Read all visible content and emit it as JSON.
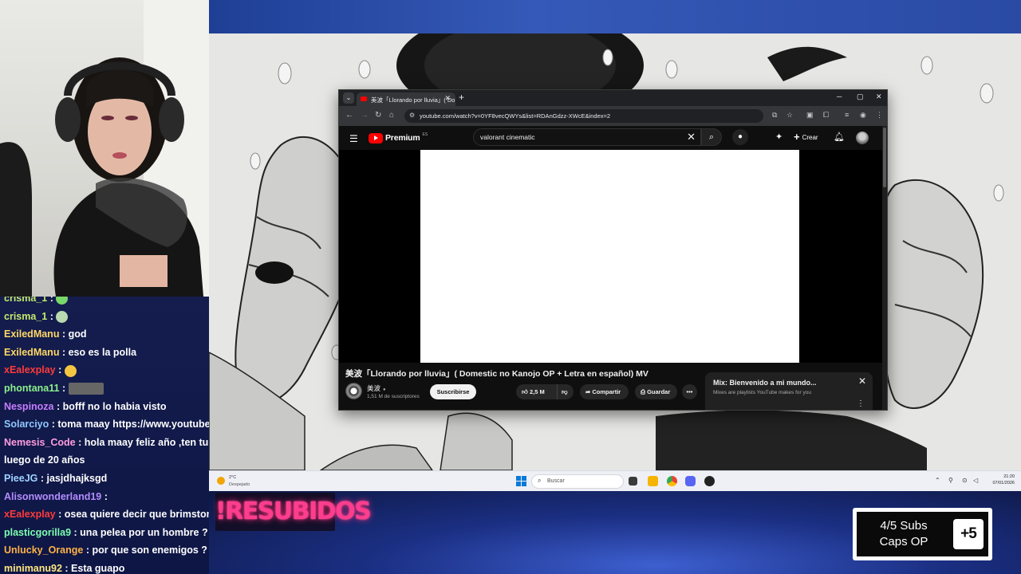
{
  "browser": {
    "tab_title": "美波「Llorando por lluvia」( Dom",
    "url": "youtube.com/watch?v=0YF8vecQWYs&list=RDAnGdzz-XWcE&index=2"
  },
  "youtube": {
    "logo_text": "Premium",
    "logo_region": "ES",
    "search_query": "valorant cinematic",
    "create_label": "Crear",
    "video_title": "美波「Llorando por lluvia」( Domestic no Kanojo OP + Letra en español) MV",
    "channel_name": "美波",
    "channel_subs": "1,51 M de suscriptores",
    "subscribe_label": "Suscribirse",
    "likes": "2,5 M",
    "share_label": "Compartir",
    "save_label": "Guardar",
    "mix_title": "Mix: Bienvenido a mi mundo...",
    "mix_subtitle": "Mixes are playlists YouTube makes for you"
  },
  "taskbar": {
    "temp": "2°C",
    "condition": "Despejado",
    "search_placeholder": "Buscar",
    "time": "21:20",
    "date": "07/01/2026"
  },
  "chat": [
    {
      "user": "crisma_1",
      "color": "#c5e86c",
      "text": "",
      "emote": "#7ad76a"
    },
    {
      "user": "crisma_1",
      "color": "#c5e86c",
      "text": "",
      "emote": "#b9d9b0"
    },
    {
      "user": "ExiledManu",
      "color": "#ffd866",
      "text": "god"
    },
    {
      "user": "ExiledManu",
      "color": "#ffd866",
      "text": "eso es la polla"
    },
    {
      "user": "xEalexplay",
      "color": "#ff3b3b",
      "text": "",
      "emote": "#f5c542"
    },
    {
      "user": "phontana11",
      "color": "#8cf08c",
      "text": "",
      "emote_wide": "#666"
    },
    {
      "user": "Nespinoza",
      "color": "#c77dff",
      "text": "bofff no lo habia visto"
    },
    {
      "user": "Solarciyo",
      "color": "#8fc7ff",
      "text": "toma maay https://www.youtube.c"
    },
    {
      "user": "Nemesis_Code",
      "color": "#ff9ce0",
      "text": "hola maay feliz año ,ten tu p"
    },
    {
      "user": "",
      "color": "#fff",
      "text": "luego de 20 años"
    },
    {
      "user": "PieeJG",
      "color": "#9fd3ff",
      "text": "jasjdhajksgd"
    },
    {
      "user": "Alisonwonderland19",
      "color": "#b48cff",
      "text": ""
    },
    {
      "user": "xEalexplay",
      "color": "#ff3b3b",
      "text": "osea quiere decir que brimstone"
    },
    {
      "user": "plasticgorilla9",
      "color": "#7dffb0",
      "text": "una pelea por un hombre ?"
    },
    {
      "user": "Unlucky_Orange",
      "color": "#ffb347",
      "text": "por que son enemigos ?"
    },
    {
      "user": "minimanu92",
      "color": "#ffe680",
      "text": "Esta guapo"
    }
  ],
  "overlay": {
    "resubidos": "!RESUBIDOS",
    "subs_line1": "4/5 Subs",
    "subs_line2": "Caps OP",
    "plus": "+5"
  }
}
